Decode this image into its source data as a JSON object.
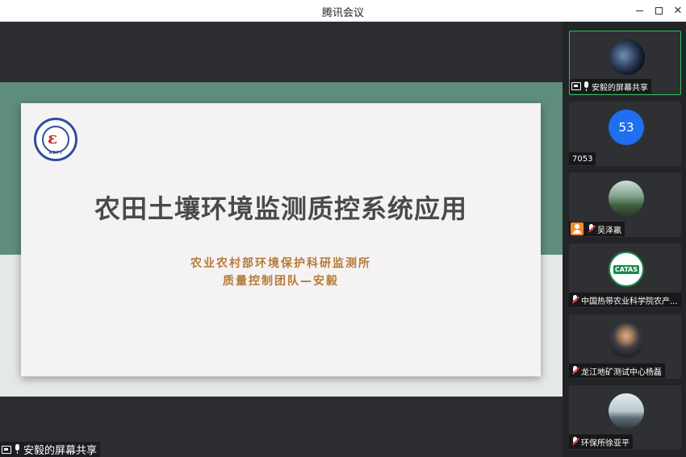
{
  "window": {
    "title": "腾讯会议"
  },
  "slide": {
    "logo_text": "AEPI",
    "title": "农田土壤环境监测质控系统应用",
    "org": "农业农村部环境保护科研监测所",
    "team": "质量控制团队—安毅"
  },
  "share_label": "安毅的屏幕共享",
  "participants": [
    {
      "label": "安毅的屏幕共享",
      "status": "sharing"
    },
    {
      "avatar_text": "53",
      "label": "7053",
      "status": "none"
    },
    {
      "label": "吴泽嬴",
      "status": "muted"
    },
    {
      "avatar_text": "CATAS",
      "label": "中国热带农业科学院农产...",
      "status": "muted"
    },
    {
      "label": "龙江地矿测试中心杨磊",
      "status": "muted"
    },
    {
      "label": "环保所徐亚平",
      "status": "muted"
    }
  ],
  "colors": {
    "accent_green": "#2bc15a",
    "slide_title": "#4a4a4a",
    "slide_subtitle": "#b47b35",
    "avatar_blue": "#1e6ff1"
  }
}
